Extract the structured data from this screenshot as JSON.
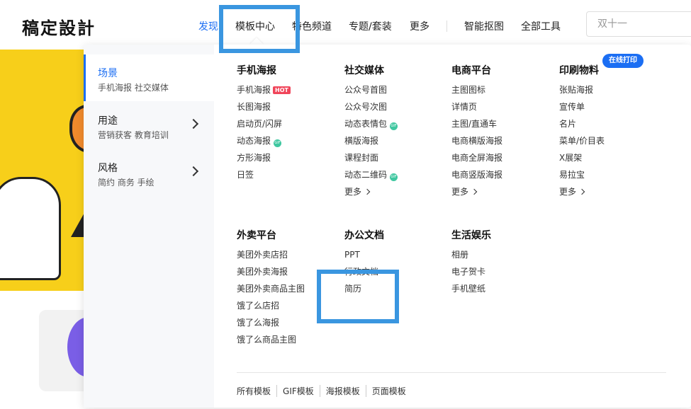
{
  "header": {
    "logo": "稿定設計",
    "nav": [
      {
        "label": "发现",
        "active": true
      },
      {
        "label": "模板中心",
        "active": false
      },
      {
        "label": "特色频道",
        "active": false
      },
      {
        "label": "专题/套装",
        "active": false
      },
      {
        "label": "更多",
        "active": false
      },
      {
        "label": "智能抠图",
        "active": false
      },
      {
        "label": "全部工具",
        "active": false
      }
    ],
    "search_placeholder": "双十一"
  },
  "sidebar": [
    {
      "title": "场景",
      "sub": "手机海报 社交媒体",
      "active": true
    },
    {
      "title": "用途",
      "sub": "营销获客 教育培训",
      "active": false
    },
    {
      "title": "风格",
      "sub": "简约 商务 手绘",
      "active": false
    }
  ],
  "columns": [
    {
      "heading": "手机海报",
      "items": [
        "手机海报",
        "长图海报",
        "启动页/闪屏",
        "动态海报",
        "方形海报",
        "日签"
      ]
    },
    {
      "heading": "社交媒体",
      "items": [
        "公众号首图",
        "公众号次图",
        "动态表情包",
        "横版海报",
        "课程封面",
        "动态二维码"
      ],
      "more": "更多"
    },
    {
      "heading": "电商平台",
      "items": [
        "主图图标",
        "详情页",
        "主图/直通车",
        "电商横版海报",
        "电商全屏海报",
        "电商竖版海报"
      ],
      "more": "更多"
    },
    {
      "heading": "印刷物料",
      "items": [
        "张贴海报",
        "宣传单",
        "名片",
        "菜单/价目表",
        "X展架",
        "易拉宝"
      ],
      "more": "更多"
    },
    {
      "heading": "外卖平台",
      "items": [
        "美团外卖店招",
        "美团外卖海报",
        "美团外卖商品主图",
        "饿了么店招",
        "饿了么海报",
        "饿了么商品主图"
      ]
    },
    {
      "heading": "办公文档",
      "items": [
        "PPT",
        "行政文档",
        "简历"
      ]
    },
    {
      "heading": "生活娱乐",
      "items": [
        "相册",
        "电子贺卡",
        "手机壁纸"
      ]
    }
  ],
  "badges": {
    "hot": "HOT",
    "gif": "GIF",
    "print_pill": "在线打印"
  },
  "footer": [
    "所有模板",
    "GIF模板",
    "海报模板",
    "页面模板"
  ],
  "colors": {
    "accent": "#1b6ef3",
    "banner": "#f7cf1a",
    "highlight": "#3a96e0",
    "hot": "#f0455a",
    "gif": "#3fc7a0"
  }
}
